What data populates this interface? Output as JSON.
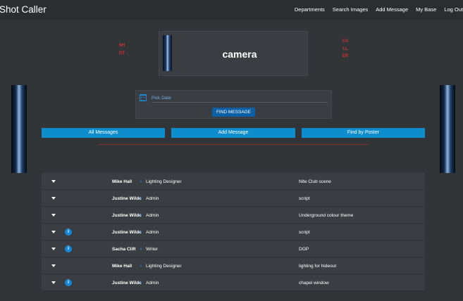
{
  "navbar": {
    "brand": "Shot Caller",
    "links": [
      "Departments",
      "Search Images",
      "Add Message",
      "My Base",
      "Log Out"
    ]
  },
  "side_text": {
    "left": "SHOT",
    "right": "CALLER"
  },
  "camera_card": {
    "title": "camera"
  },
  "date_form": {
    "placeholder": "Pick Date",
    "button_label": "FIND MESSAGE"
  },
  "actions": {
    "all_messages": "All Messages",
    "add_message": "Add Message",
    "find_by_poster": "Find by Poster"
  },
  "messages": [
    {
      "poster": "Mike Hall",
      "department": "Lighting Designer",
      "subject": "Nite Club scene",
      "info": false
    },
    {
      "poster": "Justine Wilde",
      "department": "Admin",
      "subject": "script",
      "info": false
    },
    {
      "poster": "Justine Wilde",
      "department": "Admin",
      "subject": "Underground colour theme",
      "info": false
    },
    {
      "poster": "Justine Wilde",
      "department": "Admin",
      "subject": "script",
      "info": true
    },
    {
      "poster": "Sacha Clift",
      "department": "Writer",
      "subject": "DOP",
      "info": true
    },
    {
      "poster": "Mike Hall",
      "department": "Lighting Designer",
      "subject": "lighting for hideout",
      "info": false
    },
    {
      "poster": "Justine Wilde",
      "department": "Admin",
      "subject": "chapel window",
      "info": true
    }
  ],
  "colors": {
    "accent": "#0d8dcb",
    "button": "#0b5fa4",
    "side_text": "#d4302f",
    "background": "#323537"
  },
  "icons": {
    "row_toggle": "caret-down-icon",
    "info": "info-icon",
    "date": "calendar-icon"
  }
}
